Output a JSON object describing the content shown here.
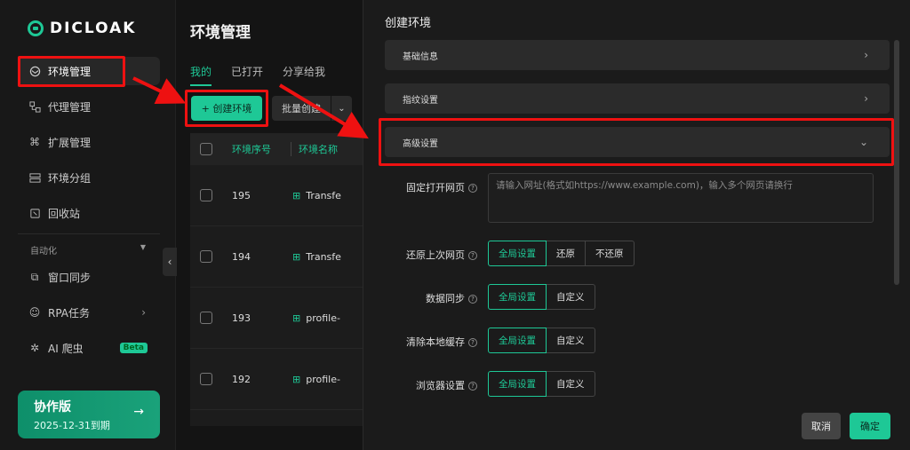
{
  "app": {
    "logo_text": "DICLOAK"
  },
  "sidebar": {
    "items": [
      {
        "label": "环境管理",
        "icon": "globe-icon"
      },
      {
        "label": "代理管理",
        "icon": "proxy-icon"
      },
      {
        "label": "扩展管理",
        "icon": "extension-icon"
      },
      {
        "label": "环境分组",
        "icon": "group-icon"
      },
      {
        "label": "回收站",
        "icon": "trash-icon"
      }
    ],
    "group_label": "自动化",
    "auto_items": [
      {
        "label": "窗口同步",
        "icon": "sync-icon"
      },
      {
        "label": "RPA任务",
        "icon": "robot-icon"
      },
      {
        "label": "AI 爬虫",
        "icon": "spider-icon",
        "badge": "Beta"
      }
    ],
    "plan": {
      "title": "协作版",
      "expiry": "2025-12-31到期"
    }
  },
  "main": {
    "title": "环境管理",
    "tabs": [
      "我的",
      "已打开",
      "分享给我"
    ],
    "create_button": "+ 创建环境",
    "batch_button": "批量创建",
    "table": {
      "headers": [
        "环境序号",
        "环境名称"
      ],
      "rows": [
        {
          "num": "195",
          "name": "Transfe"
        },
        {
          "num": "194",
          "name": "Transfe"
        },
        {
          "num": "193",
          "name": "profile-"
        },
        {
          "num": "192",
          "name": "profile-"
        }
      ]
    }
  },
  "modal": {
    "title": "创建环境",
    "sections": [
      "基础信息",
      "指纹设置",
      "高级设置"
    ],
    "fields": {
      "fixed_page": {
        "label": "固定打开网页",
        "placeholder": "请输入网址(格式如https://www.example.com)，输入多个网页请换行"
      },
      "restore_page": {
        "label": "还原上次网页",
        "options": [
          "全局设置",
          "还原",
          "不还原"
        ],
        "selected": "全局设置"
      },
      "data_sync": {
        "label": "数据同步",
        "options": [
          "全局设置",
          "自定义"
        ],
        "selected": "全局设置"
      },
      "clear_cache": {
        "label": "清除本地缓存",
        "options": [
          "全局设置",
          "自定义"
        ],
        "selected": "全局设置"
      },
      "browser_settings": {
        "label": "浏览器设置",
        "options": [
          "全局设置",
          "自定义"
        ],
        "selected": "全局设置"
      }
    },
    "cancel_label": "取消",
    "ok_label": "确定"
  },
  "colors": {
    "accent": "#1ec896",
    "highlight": "#e11111"
  }
}
